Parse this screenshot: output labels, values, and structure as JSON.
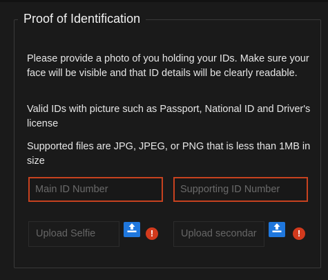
{
  "section": {
    "title": "Proof of Identification",
    "instructions": [
      "Please provide a photo of you holding your IDs. Make sure your face will be visible and that ID details will be clearly readable.",
      "Valid IDs with picture such as Passport, National ID and Driver's license",
      "Supported files are JPG, JPEG, or PNG that is less than 1MB in size"
    ]
  },
  "inputs": {
    "main_id_placeholder": "Main ID Number",
    "supporting_id_placeholder": "Supporting ID Number"
  },
  "uploads": {
    "selfie_label": "Upload Selfie",
    "secondary_label": "Upload secondar",
    "warning_glyph": "!"
  },
  "icons": {
    "upload": "upload-icon",
    "warning": "warning-icon"
  },
  "colors": {
    "background": "#1a1a1a",
    "error_border": "#c8421f",
    "upload_button": "#1f77dd",
    "warning": "#d23a1d"
  }
}
